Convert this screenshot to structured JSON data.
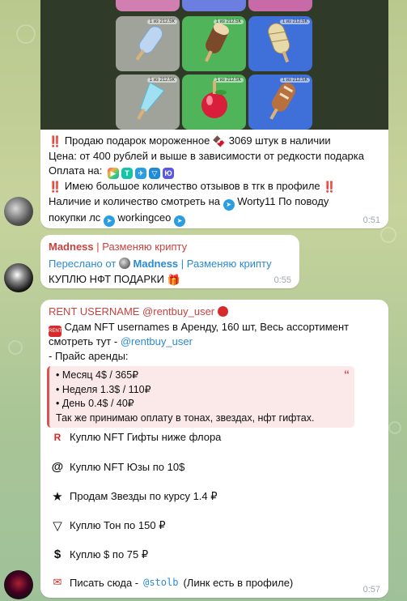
{
  "msg1": {
    "lines": {
      "l1": "Продаю подарок мороженное",
      "l1b": "3069 штук в наличии",
      "l2": "Цена: от 400 рублей и выше в зависимости от редкости подарка",
      "l3": "Оплата на:",
      "l4": "Имею большое количество отзывов в тгк в профиле",
      "l5a": "Наличие и количество смотреть на",
      "l5b": "Worty11 По поводу",
      "l6a": "покупки лс",
      "l6b": "workingceo"
    },
    "time": "0:51",
    "tile_tag": "1 из 212.5К"
  },
  "msg2": {
    "sender": "Madness",
    "sender_suffix": "| Разменяю крипту",
    "forwarded_prefix": "Переслано от",
    "forwarded_name": "Madness",
    "forwarded_suffix": "| Разменяю крипту",
    "text": "КУПЛЮ НФТ ПОДАРКИ",
    "time": "0:55"
  },
  "msg3": {
    "sender": "RENT USERNAME @rentbuy_user",
    "line1": "Сдам NFT usernames в Аренду, 160 шт, Весь ассортимент",
    "line2a": "смотреть тут -",
    "line2b": "@rentbuy_user",
    "line3": "- Прайс аренды:",
    "quote": [
      "• Месяц 4$ / 365₽",
      "• Неделя 1.3$ / 110₽",
      "• День 0.4$ / 40₽",
      "Так же принимаю оплату в тонах, звездах, нфт гифтах."
    ],
    "items": [
      "Куплю NFT Гифты ниже флора",
      "Куплю NFT Юзы по 10$",
      "Продам Звезды по курсу 1.4 ₽",
      "Куплю Тон по 150 ₽",
      "Куплю $ по 75 ₽"
    ],
    "last_a": "Писать сюда -",
    "last_b": "@stolb",
    "last_c": "(Линк  есть в профиле)",
    "time": "0:57"
  },
  "colors": {
    "link": "#2b8ad3",
    "sender": "#c8423f",
    "quote_bg": "#fbe9ea",
    "quote_border": "#d9534f"
  }
}
